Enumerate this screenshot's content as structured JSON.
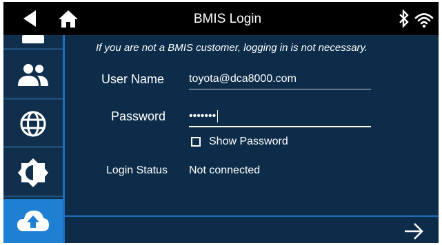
{
  "header": {
    "title": "BMIS Login",
    "icons": [
      "back-icon",
      "home-icon",
      "bluetooth-icon",
      "wifi-icon"
    ]
  },
  "sidebar": {
    "items": [
      {
        "icon": "partial-item-icon"
      },
      {
        "icon": "users-icon"
      },
      {
        "icon": "globe-icon"
      },
      {
        "icon": "brightness-icon"
      },
      {
        "icon": "cloud-upload-icon",
        "active": true
      }
    ]
  },
  "main": {
    "notice": "If you are not a BMIS customer, logging in is not necessary.",
    "username_label": "User Name",
    "username_value": "toyota@dca8000.com",
    "password_label": "Password",
    "password_value": "•••••••",
    "show_password_label": "Show Password",
    "show_password_checked": false,
    "status_label": "Login Status",
    "status_value": "Not connected",
    "next_icon": "arrow-right-icon"
  },
  "colors": {
    "topbar": "#000000",
    "background": "#0c2c49",
    "accent": "#1f7fd3",
    "divider": "#1f6fbf",
    "text": "#ffffff"
  }
}
